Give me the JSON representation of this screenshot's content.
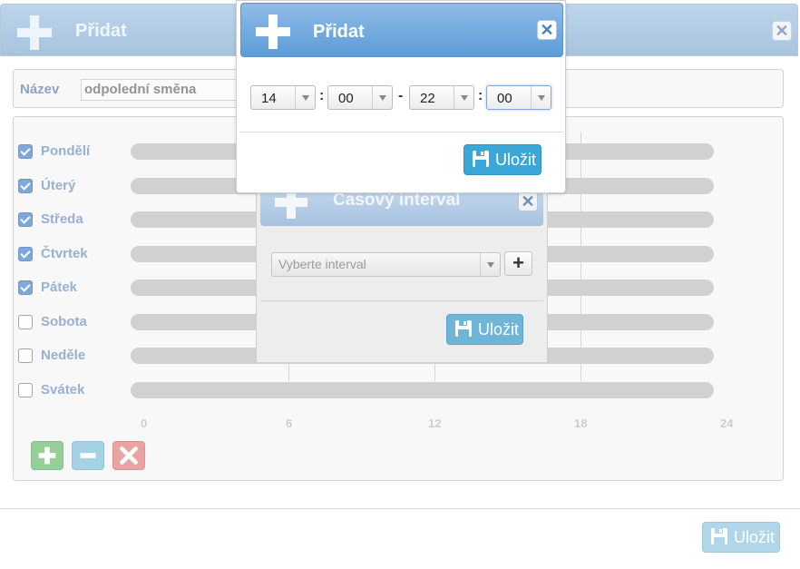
{
  "base_dialog": {
    "title": "Přidat",
    "name_label": "Název",
    "name_value": "odpolední směna",
    "days": [
      {
        "label": "Pondělí",
        "checked": true
      },
      {
        "label": "Úterý",
        "checked": true
      },
      {
        "label": "Středa",
        "checked": true
      },
      {
        "label": "Čtvrtek",
        "checked": true
      },
      {
        "label": "Pátek",
        "checked": true
      },
      {
        "label": "Sobota",
        "checked": false
      },
      {
        "label": "Neděle",
        "checked": false
      },
      {
        "label": "Svátek",
        "checked": false
      }
    ],
    "axis_labels": [
      "0",
      "6",
      "12",
      "18",
      "24"
    ],
    "save_label": "Uložit"
  },
  "interval_dialog": {
    "title": "Časový interval",
    "select_placeholder": "Vyberte interval",
    "save_label": "Uložit"
  },
  "time_dialog": {
    "title": "Přidat",
    "from_hour": "14",
    "from_minute": "00",
    "range_separator": "-",
    "time_separator": ":",
    "to_hour": "22",
    "to_minute": "00",
    "save_label": "Uložit"
  },
  "colors": {
    "header_blue": "#5d9cd8",
    "save_blue": "#3aa7d8",
    "add_green": "#79c07a",
    "remove_blue": "#8cc4de",
    "delete_red": "#e28a88",
    "checkbox_blue": "#5b8fd0"
  },
  "icons": {
    "header": "plus-icon",
    "close": "close-icon",
    "save": "floppy-disk-icon",
    "add_interval": "plus-icon",
    "add_row": "plus-icon",
    "remove_row": "minus-icon",
    "delete_row": "x-icon"
  }
}
